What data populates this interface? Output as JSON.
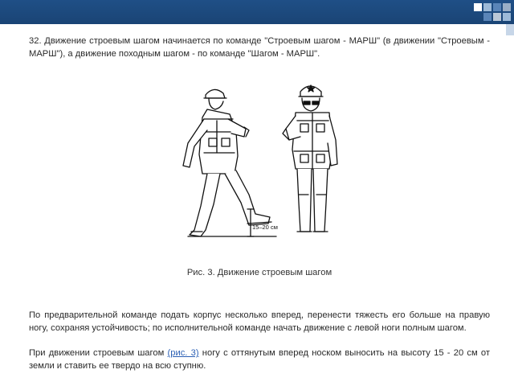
{
  "colors": {
    "header_bar": "#1f4f86",
    "link": "#2b5fb4",
    "square_a": "#ffffff",
    "square_b": "#9dbad8",
    "square_c": "#5a85b8"
  },
  "paragraph_1": "32. Движение строевым шагом начинается по команде \"Строевым шагом - МАРШ\" (в движении \"Строевым - МАРШ\"), а движение походным шагом - по команде \"Шагом - МАРШ\".",
  "figure": {
    "measure_label": "15–20 см"
  },
  "caption": "Рис. 3. Движение строевым шагом",
  "paragraph_2": "По предварительной команде подать корпус несколько вперед, перенести тяжесть его больше на правую ногу, сохраняя устойчивость; по исполнительной команде начать движение с левой ноги полным шагом.",
  "paragraph_3": {
    "before": "При движении строевым шагом ",
    "link": "(рис. 3)",
    "after": " ногу с оттянутым вперед носком выносить на высоту 15 - 20 см от земли и ставить ее твердо на всю ступню."
  }
}
